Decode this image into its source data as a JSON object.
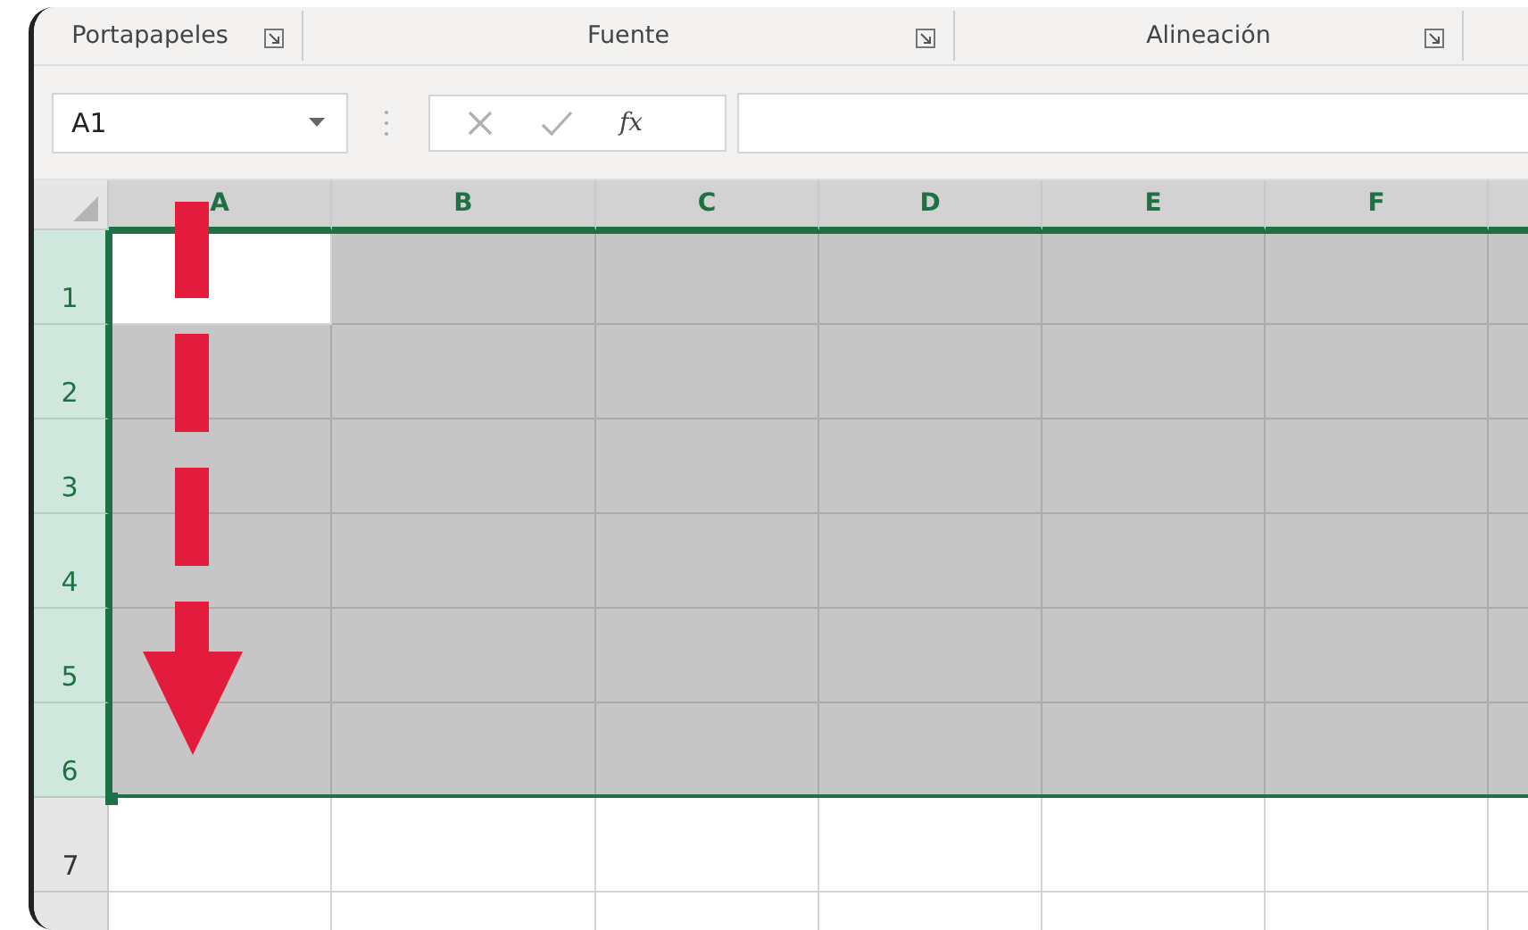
{
  "ribbon_groups": [
    {
      "label": "Portapapeles",
      "launcher": true
    },
    {
      "label": "Fuente",
      "launcher": true
    },
    {
      "label": "Alineación",
      "launcher": true
    }
  ],
  "formula_bar": {
    "name_box": "A1",
    "cancel_disabled": true,
    "enter_disabled": true,
    "function_label": "fx"
  },
  "columns": [
    {
      "label": "A",
      "selected": true
    },
    {
      "label": "B",
      "selected": true
    },
    {
      "label": "C",
      "selected": true
    },
    {
      "label": "D",
      "selected": true
    },
    {
      "label": "E",
      "selected": true
    },
    {
      "label": "F",
      "selected": true
    },
    {
      "selected": true
    }
  ],
  "rows": [
    {
      "label": "1",
      "selected": true
    },
    {
      "label": "2",
      "selected": true
    },
    {
      "label": "3",
      "selected": true
    },
    {
      "label": "4",
      "selected": true
    },
    {
      "label": "5",
      "selected": true
    },
    {
      "label": "6",
      "selected": true
    },
    {
      "label": "7",
      "selected": false
    },
    {
      "selected": false
    }
  ]
}
